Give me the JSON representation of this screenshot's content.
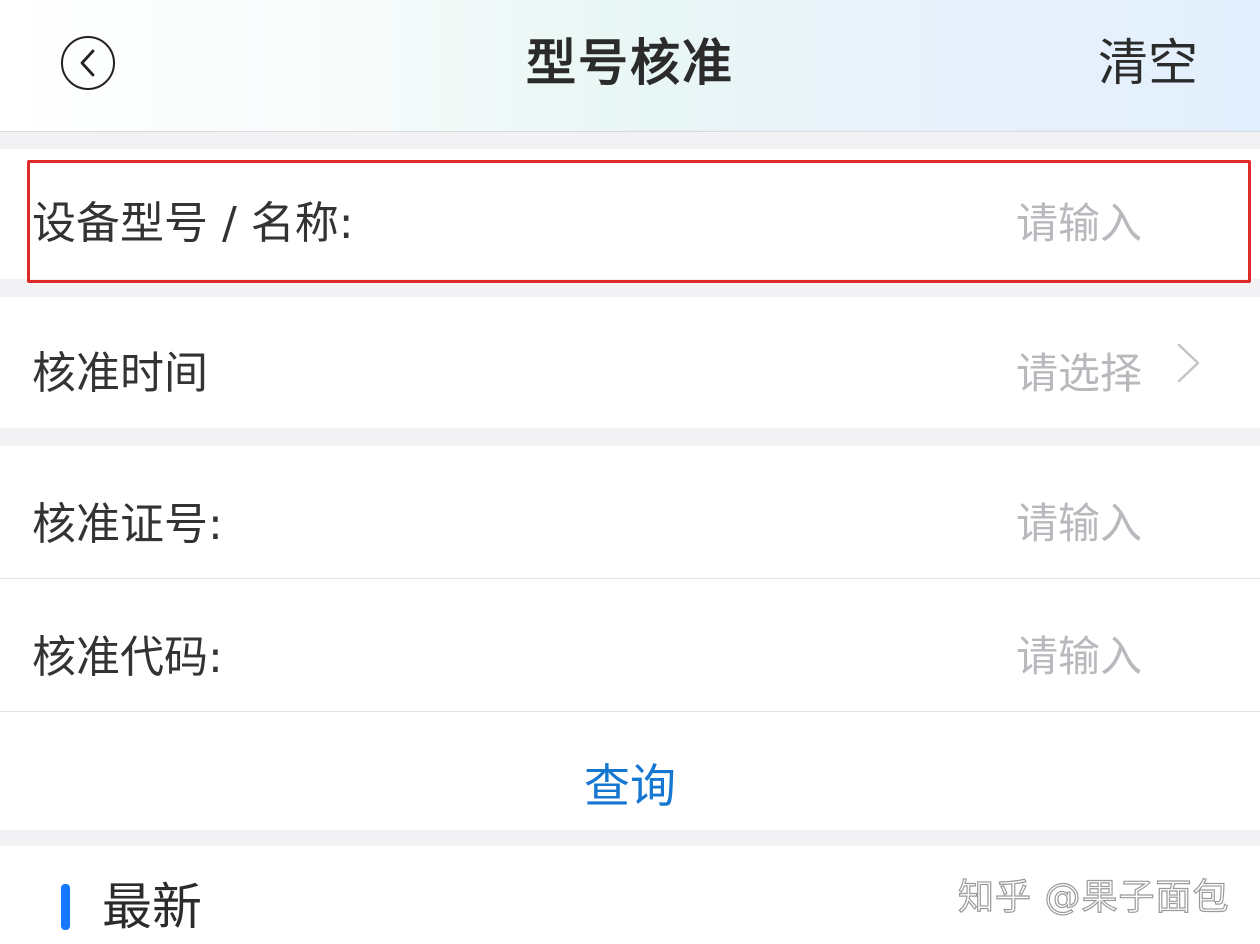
{
  "header": {
    "title": "型号核准",
    "clear_label": "清空",
    "back_icon": "chevron-left-circle-icon"
  },
  "form": {
    "rows": [
      {
        "label": "设备型号 / 名称:",
        "placeholder": "请输入",
        "type": "input",
        "highlighted": true
      },
      {
        "label": "核准时间",
        "placeholder": "请选择",
        "type": "select",
        "icon": "chevron-right-icon"
      },
      {
        "label": "核准证号:",
        "placeholder": "请输入",
        "type": "input"
      },
      {
        "label": "核准代码:",
        "placeholder": "请输入",
        "type": "input"
      }
    ],
    "query_label": "查询"
  },
  "latest": {
    "title": "最新"
  },
  "watermark": "知乎 @果子面包",
  "colors": {
    "accent": "#1677d2",
    "highlight_border": "#e02a2a",
    "placeholder": "#b8b8bd",
    "background": "#f2f2f4"
  }
}
